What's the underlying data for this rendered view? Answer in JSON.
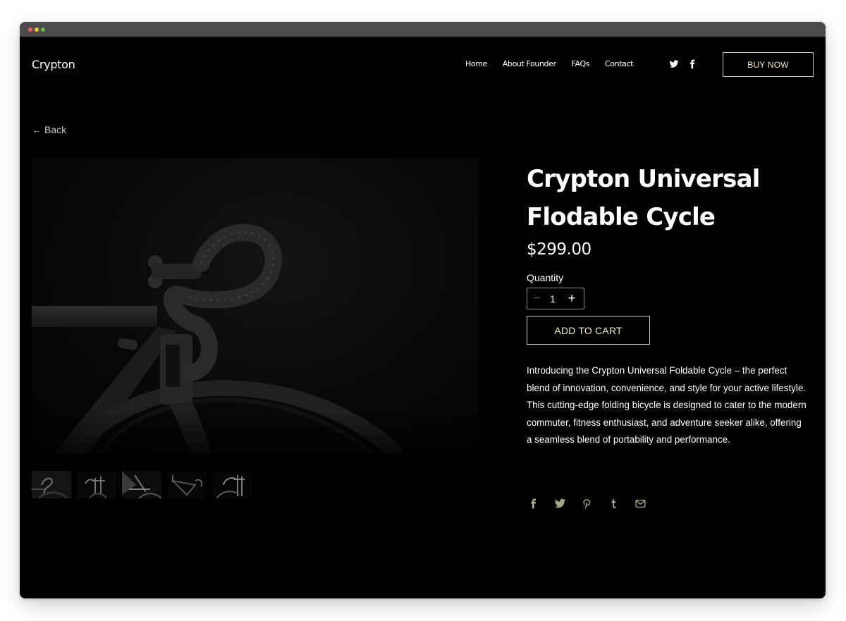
{
  "window": {
    "controls": [
      "close",
      "minimize",
      "maximize"
    ]
  },
  "header": {
    "logo": "Crypton",
    "nav": [
      {
        "label": "Home"
      },
      {
        "label": "About Founder"
      },
      {
        "label": "FAQs"
      },
      {
        "label": "Contact"
      }
    ],
    "social": [
      {
        "icon": "twitter-icon"
      },
      {
        "icon": "facebook-icon"
      }
    ],
    "cta_label": "BUY NOW"
  },
  "back": {
    "arrow": "←",
    "label": "Back"
  },
  "gallery": {
    "main_image_alt": "Close-up of black bicycle handlebars and front wheel",
    "thumbnails": [
      {
        "alt": "Handlebar close-up"
      },
      {
        "alt": "Bicycle front view"
      },
      {
        "alt": "Rider with bicycle"
      },
      {
        "alt": "Bicycle frame"
      },
      {
        "alt": "Bicycle front fork"
      }
    ]
  },
  "product": {
    "title": "Crypton Universal Flodable Cycle",
    "price": "$299.00",
    "quantity_label": "Quantity",
    "quantity": "1",
    "minus": "−",
    "plus": "+",
    "add_to_cart_label": "ADD TO CART",
    "description": "Introducing the Crypton Universal Foldable Cycle – the perfect blend of innovation, convenience, and style for your active lifestyle. This cutting-edge folding bicycle is designed to cater to the modern commuter, fitness enthusiast, and adventure seeker alike, offering a seamless blend of portability and performance.",
    "share": [
      {
        "icon": "facebook-icon"
      },
      {
        "icon": "twitter-icon"
      },
      {
        "icon": "pinterest-icon"
      },
      {
        "icon": "tumblr-icon"
      },
      {
        "icon": "email-icon"
      }
    ]
  },
  "colors": {
    "background": "#000000",
    "accent_text": "#f1e9c4",
    "button_border": "#c9c6b8",
    "share_icon": "#a6a68e",
    "titlebar": "#4b4b4b"
  }
}
